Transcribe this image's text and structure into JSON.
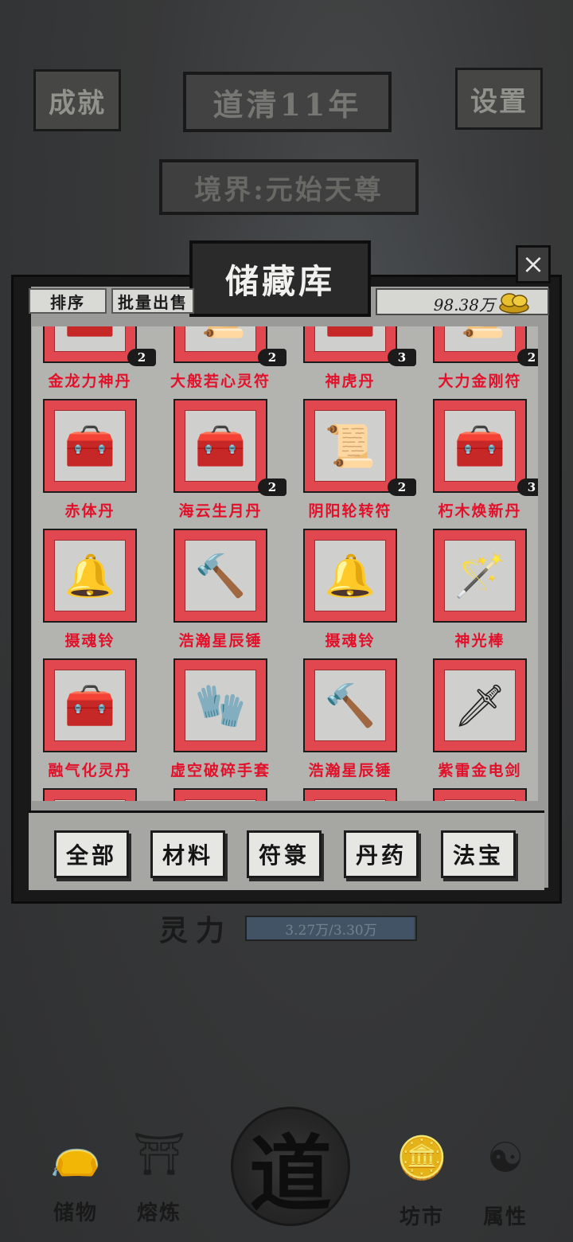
{
  "header": {
    "achievements_label": "成就",
    "settings_label": "设置",
    "year_label": "道清11年",
    "realm_label": "境界:元始天尊"
  },
  "lingli": {
    "label": "灵力",
    "value_text": "3.27万/3.30万",
    "progress": 0.99
  },
  "bottom_nav": {
    "storage": {
      "label": "储物",
      "icon": "pouch-icon"
    },
    "smelting": {
      "label": "熔炼",
      "icon": "furnace-icon"
    },
    "dao": {
      "label": "道",
      "icon": "dao-icon"
    },
    "market": {
      "label": "坊市",
      "icon": "coins-icon"
    },
    "attributes": {
      "label": "属性",
      "icon": "yin-yang-icon"
    }
  },
  "storage_modal": {
    "title": "储藏库",
    "close_label": "×",
    "sort_label": "排序",
    "batch_sell_label": "批量出售",
    "money": "98.38万",
    "money_icon": "gold-ingot-icon",
    "rows": [
      [
        {
          "name": "金龙力神丹",
          "count": "2",
          "icon": "chest-icon",
          "glyph": "🧰"
        },
        {
          "name": "大般若心灵符",
          "count": "2",
          "icon": "talisman-icon",
          "glyph": "📜"
        },
        {
          "name": "神虎丹",
          "count": "3",
          "icon": "chest-icon",
          "glyph": "🧰"
        },
        {
          "name": "大力金刚符",
          "count": "2",
          "icon": "talisman-icon",
          "glyph": "📜"
        }
      ],
      [
        {
          "name": "赤体丹",
          "count": "",
          "icon": "red-pill-chest-icon",
          "glyph": "🧰"
        },
        {
          "name": "海云生月丹",
          "count": "2",
          "icon": "blue-pill-chest-icon",
          "glyph": "🧰"
        },
        {
          "name": "阴阳轮转符",
          "count": "2",
          "icon": "talisman-scroll-icon",
          "glyph": "📜"
        },
        {
          "name": "朽木焕新丹",
          "count": "3",
          "icon": "green-pill-chest-icon",
          "glyph": "🧰"
        }
      ],
      [
        {
          "name": "摄魂铃",
          "count": "",
          "icon": "bell-icon",
          "glyph": "🔔"
        },
        {
          "name": "浩瀚星辰锤",
          "count": "",
          "icon": "hammer-icon",
          "glyph": "🔨"
        },
        {
          "name": "摄魂铃",
          "count": "",
          "icon": "bell-icon",
          "glyph": "🔔"
        },
        {
          "name": "神光棒",
          "count": "",
          "icon": "staff-icon",
          "glyph": "🪄"
        }
      ],
      [
        {
          "name": "融气化灵丹",
          "count": "",
          "icon": "pink-pill-chest-icon",
          "glyph": "🧰"
        },
        {
          "name": "虚空破碎手套",
          "count": "",
          "icon": "glove-icon",
          "glyph": "🧤"
        },
        {
          "name": "浩瀚星辰锤",
          "count": "",
          "icon": "hammer-icon",
          "glyph": "🔨"
        },
        {
          "name": "紫雷金电剑",
          "count": "",
          "icon": "sword-icon",
          "glyph": "🗡"
        }
      ],
      [
        {
          "name": "",
          "count": "",
          "icon": "item-icon",
          "glyph": "🟫"
        },
        {
          "name": "",
          "count": "",
          "icon": "item-icon",
          "glyph": "🔴"
        },
        {
          "name": "",
          "count": "",
          "icon": "item-icon",
          "glyph": "🟪"
        },
        {
          "name": "",
          "count": "",
          "icon": "item-icon",
          "glyph": "🟣"
        }
      ]
    ],
    "categories": [
      "全部",
      "材料",
      "符箓",
      "丹药",
      "法宝"
    ]
  },
  "colors": {
    "item_name_red": "#e3102a",
    "tile_red": "#e1474e",
    "panel_gray": "#9a9a98",
    "ink_black": "#191919"
  }
}
